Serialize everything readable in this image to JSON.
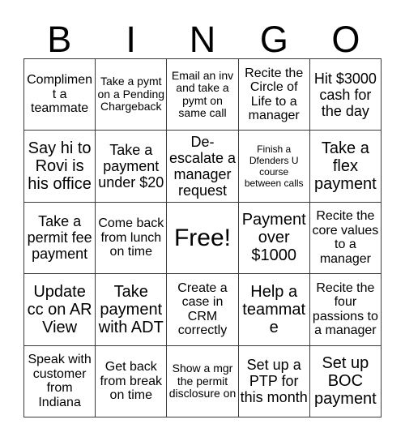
{
  "card": {
    "title": "BINGO",
    "headers": [
      "B",
      "I",
      "N",
      "G",
      "O"
    ],
    "free_space_label": "Free!",
    "colors": {
      "background": "#ffffff",
      "text": "#000000",
      "grid_line": "#3a3a3a"
    },
    "grid_size": "5x5",
    "rows": [
      [
        {
          "text": "Compliment a teammate",
          "size": "md"
        },
        {
          "text": "Take a pymt on a Pending Chargeback",
          "size": "sm"
        },
        {
          "text": "Email an inv and take a pymt on same call",
          "size": "sm"
        },
        {
          "text": "Recite the Circle of Life to a manager",
          "size": "md"
        },
        {
          "text": "Hit $3000 cash for the day",
          "size": "lg"
        }
      ],
      [
        {
          "text": "Say hi to Rovi is his office",
          "size": "xl"
        },
        {
          "text": "Take a payment under $20",
          "size": "lg"
        },
        {
          "text": "De-escalate a manager request",
          "size": "lg"
        },
        {
          "text": "Finish a Dfenders U course between calls",
          "size": "xs"
        },
        {
          "text": "Take a flex payment",
          "size": "xl"
        }
      ],
      [
        {
          "text": "Take a permit fee payment",
          "size": "lg"
        },
        {
          "text": "Come back from lunch on time",
          "size": "md"
        },
        {
          "text": "Free!",
          "size": "xxl"
        },
        {
          "text": "Payment over $1000",
          "size": "xl"
        },
        {
          "text": "Recite the core values to a manager",
          "size": "md"
        }
      ],
      [
        {
          "text": "Update cc on AR View",
          "size": "xl"
        },
        {
          "text": "Take payment with ADT",
          "size": "xl"
        },
        {
          "text": "Create a case in CRM correctly",
          "size": "md"
        },
        {
          "text": "Help a teammate",
          "size": "xl"
        },
        {
          "text": "Recite the four passions to a manager",
          "size": "md"
        }
      ],
      [
        {
          "text": "Speak with customer from Indiana",
          "size": "md"
        },
        {
          "text": "Get back from break on time",
          "size": "md"
        },
        {
          "text": "Show a mgr the permit disclosure on",
          "size": "sm"
        },
        {
          "text": "Set up a PTP for this month",
          "size": "lg"
        },
        {
          "text": "Set up BOC payment",
          "size": "xl"
        }
      ]
    ]
  }
}
